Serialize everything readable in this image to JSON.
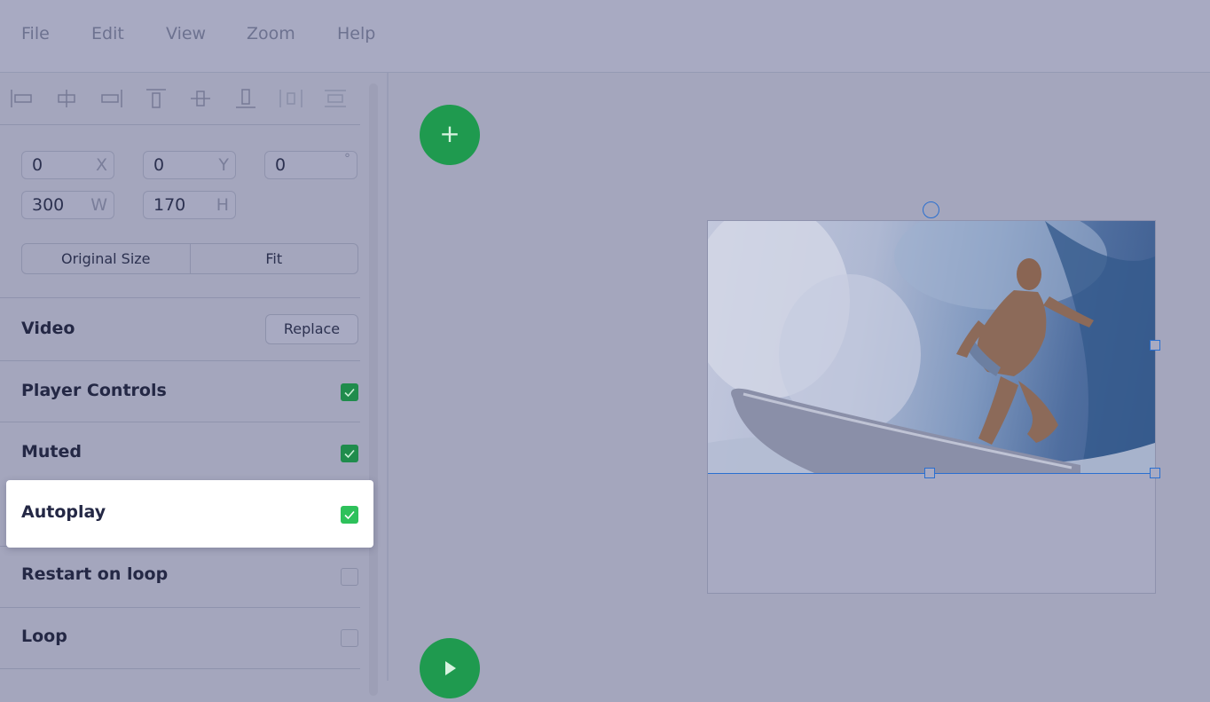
{
  "menu": {
    "file": "File",
    "edit": "Edit",
    "view": "View",
    "zoom": "Zoom",
    "help": "Help"
  },
  "align_tools": [
    "align-left-icon",
    "align-center-horizontal-icon",
    "align-right-icon",
    "align-top-icon",
    "align-middle-vertical-icon",
    "align-bottom-icon",
    "distribute-horizontal-icon",
    "distribute-vertical-icon"
  ],
  "transform": {
    "x": {
      "value": "0",
      "unit": "X"
    },
    "y": {
      "value": "0",
      "unit": "Y"
    },
    "rotation": {
      "value": "0",
      "unit": "°"
    },
    "width": {
      "value": "300",
      "unit": "W"
    },
    "height": {
      "value": "170",
      "unit": "H"
    },
    "original_size_label": "Original Size",
    "fit_label": "Fit"
  },
  "video_section": {
    "label": "Video",
    "replace_label": "Replace"
  },
  "options": {
    "player_controls": {
      "label": "Player Controls",
      "checked": true
    },
    "muted": {
      "label": "Muted",
      "checked": true
    },
    "autoplay": {
      "label": "Autoplay",
      "checked": true
    },
    "restart_on_loop": {
      "label": "Restart on loop",
      "checked": false
    },
    "loop": {
      "label": "Loop",
      "checked": false
    }
  },
  "canvas": {
    "add_button_label": "+",
    "video_thumbnail": "surfer-riding-wave"
  },
  "colors": {
    "accent_green": "#1f9a4f",
    "checkbox_green": "#1f8c4c",
    "selection_blue": "#2a6fd0",
    "highlight": "#ffffff"
  }
}
